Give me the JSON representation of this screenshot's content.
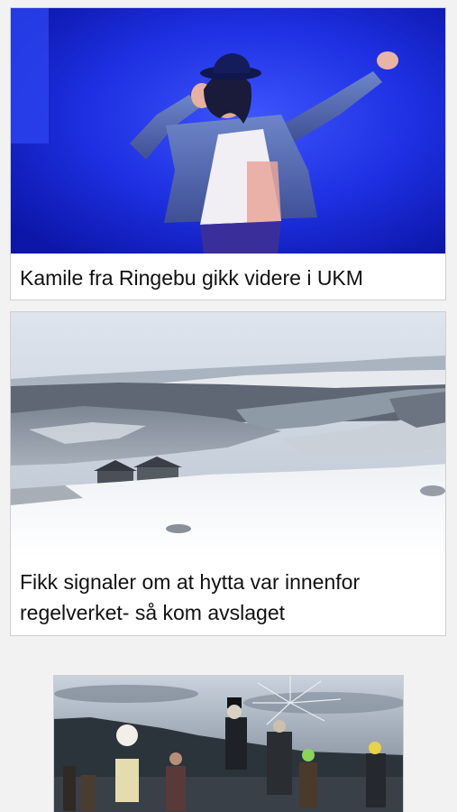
{
  "articles": [
    {
      "title": "Kamile fra Ringebu gikk videre i UKM",
      "image_icon": "dancer-on-stage-photo"
    },
    {
      "title": "Fikk signaler om at hytta var innenfor regelverket- så kom avslaget",
      "image_icon": "snowy-mountain-cabin-photo"
    },
    {
      "title": "",
      "image_icon": "outdoor-theatre-performance-photo"
    }
  ],
  "colors": {
    "background": "#f2f2f2",
    "card": "#ffffff",
    "border": "#cfcfcf",
    "text": "#111111",
    "stage_blue": "#1a2fd6"
  }
}
